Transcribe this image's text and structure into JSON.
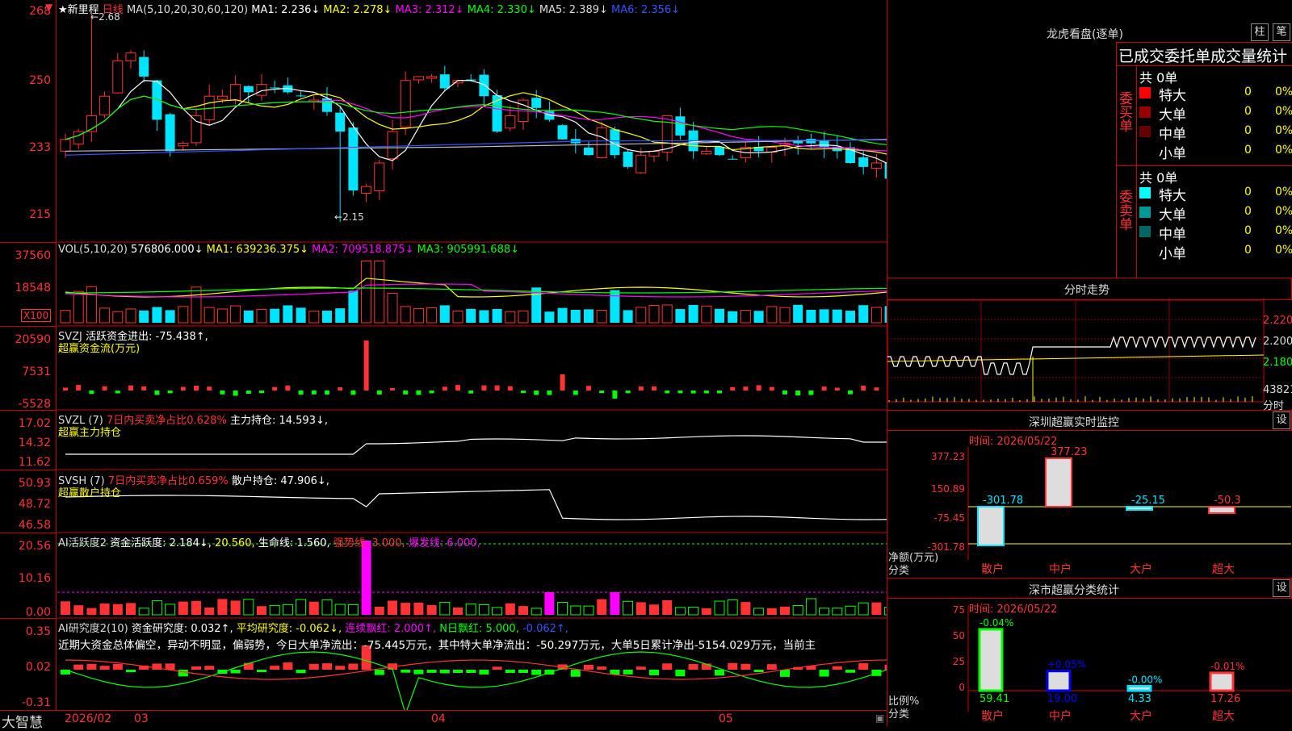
{
  "colors": {
    "up": "#ff3333",
    "down": "#00e5ff",
    "grid": "#cc0000"
  },
  "main": {
    "stock_title": "★新里程",
    "period": "日线",
    "ma_label": "MA(5,10,20,30,60,120)",
    "ma1": "MA1: 2.236↓",
    "ma2": "MA2: 2.278↓",
    "ma3": "MA3: 2.312↓",
    "ma4": "MA4: 2.330↓",
    "ma5": "MA5: 2.389↓",
    "ma6": "MA6: 2.356↓",
    "high_marker": "2.68",
    "low_marker": "2.15",
    "y_ticks": [
      "268",
      "250",
      "233",
      "215"
    ]
  },
  "vol": {
    "title": "VOL(5,10,20)",
    "value": "576806.000↓",
    "ma1": "MA1: 639236.375↓",
    "ma2": "MA2: 709518.875↓",
    "ma3": "MA3: 905991.688↓",
    "y_ticks": [
      "37560",
      "18548"
    ],
    "unit": "X100"
  },
  "svzj": {
    "title": "SVZJ",
    "line1": "活跃资金进出: -75.438↑,",
    "line2": "超赢资金流(万元)",
    "y_ticks": [
      "20590",
      "7531",
      "-5528"
    ]
  },
  "svzl": {
    "title": "SVZL (7)",
    "ratio": "7日内买卖净占比0.628%",
    "hold": "主力持仓: 14.593↓,",
    "line2": "超赢主力持仓",
    "y_ticks": [
      "17.02",
      "14.32",
      "11.62"
    ]
  },
  "svsh": {
    "title": "SVSH (7)",
    "ratio": "7日内买卖净占比0.659%",
    "hold": "散户持仓: 47.906↓,",
    "line2": "超赢散户持仓",
    "y_ticks": [
      "50.93",
      "48.72",
      "46.58"
    ]
  },
  "ai_active": {
    "title": "AI活跃度2",
    "v1": "资金活跃度: 2.184↓,",
    "v2": "20.560,",
    "v3": "生命线: 1.560,",
    "v4": "强势线: 3.000,",
    "v5": "爆发线: 6.000,",
    "y_ticks": [
      "20.56",
      "10.16",
      "0.00"
    ]
  },
  "ai_research": {
    "title": "AI研究度2(10)",
    "v1": "资金研究度: 0.032↑,",
    "v2": "平均研究度: -0.062↓,",
    "v3": "连续飘红: 2.000↑,",
    "v4": "N日飘红: 5.000,",
    "v5": "-0.062↑,",
    "summary": "近期大资金总体偏空，异动不明显，偏弱势，今日大单净流出：-75.445万元，其中特大单净流出：-50.297万元，大单5日累计净出-5154.029万元，当前主",
    "y_ticks": [
      "0.35",
      "0.02",
      "-0.31"
    ]
  },
  "xaxis": {
    "brand": "大智慧",
    "labels": [
      "2026/02",
      "03",
      "04",
      "05"
    ]
  },
  "dragon": {
    "title": "龙虎看盘(逐单)",
    "btn1": "柱",
    "btn2": "笔",
    "header": "已成交委托单成交量统计",
    "buy_label": "委买单",
    "sell_label": "委卖单",
    "buy_total": "共 0单",
    "sell_total": "共 0单",
    "buy_rows": [
      {
        "name": "特大",
        "count": "0",
        "pct": "0%"
      },
      {
        "name": "大单",
        "count": "0",
        "pct": "0%"
      },
      {
        "name": "中单",
        "count": "0",
        "pct": "0%"
      },
      {
        "name": "小单",
        "count": "0",
        "pct": "0%"
      }
    ],
    "sell_rows": [
      {
        "name": "特大",
        "count": "0",
        "pct": "0%"
      },
      {
        "name": "大单",
        "count": "0",
        "pct": "0%"
      },
      {
        "name": "中单",
        "count": "0",
        "pct": "0%"
      },
      {
        "name": "小单",
        "count": "0",
        "pct": "0%"
      }
    ],
    "buy_colors": [
      "#ff0000",
      "#990000",
      "#660000",
      "#000000"
    ],
    "sell_colors": [
      "#00ffff",
      "#009999",
      "#006666",
      "#000000"
    ]
  },
  "intraday": {
    "title": "分时走势",
    "y_ticks": [
      "2.220",
      "2.200",
      "2.180"
    ],
    "vol_label": "43821",
    "unit": "分时"
  },
  "monitor": {
    "title": "深圳超赢实时监控",
    "btn": "设",
    "time": "时间: 2026/05/22",
    "y_ticks": [
      "377.23",
      "150.89",
      "-75.45",
      "-301.78"
    ],
    "axis_label": "净额(万元)",
    "cat_label": "分类",
    "categories": [
      "散户",
      "中户",
      "大户",
      "超大"
    ],
    "values": [
      -301.78,
      377.23,
      -25.15,
      -50.3
    ],
    "value_labels": [
      "-301.78",
      "377.23",
      "-25.15",
      "-50.3"
    ]
  },
  "classify": {
    "title": "深市超赢分类统计",
    "btn": "设",
    "time": "时间: 2026/05/22",
    "y_ticks": [
      "75",
      "50",
      "25",
      "0"
    ],
    "axis_label": "比例%",
    "cat_label": "分类",
    "categories": [
      "散户",
      "中户",
      "大户",
      "超大"
    ],
    "values": [
      59.41,
      19.0,
      4.33,
      17.26
    ],
    "value_labels": [
      "59.41",
      "19.00",
      "4.33",
      "17.26"
    ],
    "changes": [
      "-0.04%",
      "+0.05%",
      "-0.00%",
      "-0.01%"
    ]
  },
  "chart_data": [
    {
      "type": "candlestick",
      "title": "★新里程 日线",
      "y_range": [
        2.15,
        2.68
      ],
      "close_series": [
        2.36,
        2.38,
        2.42,
        2.47,
        2.56,
        2.58,
        2.52,
        2.41,
        2.33,
        2.35,
        2.42,
        2.47,
        2.47,
        2.5,
        2.48,
        2.5,
        2.49,
        2.48,
        2.47,
        2.46,
        2.43,
        2.38,
        2.23,
        2.24,
        2.3,
        2.38,
        2.51,
        2.52,
        2.52,
        2.49,
        2.51,
        2.51,
        2.47,
        2.38,
        2.42,
        2.46,
        2.44,
        2.41,
        2.36,
        2.35,
        2.32,
        2.39,
        2.32,
        2.29,
        2.32,
        2.33,
        2.42,
        2.37,
        2.33,
        2.33,
        2.32,
        2.31,
        2.34,
        2.33,
        2.34,
        2.35,
        2.35,
        2.35,
        2.34,
        2.33,
        2.3,
        2.29,
        2.3,
        2.26,
        2.23,
        2.21,
        2.21
      ]
    },
    {
      "type": "bar",
      "title": "SVZJ 超赢资金流(万元)",
      "note": "daily net flow bars"
    }
  ]
}
